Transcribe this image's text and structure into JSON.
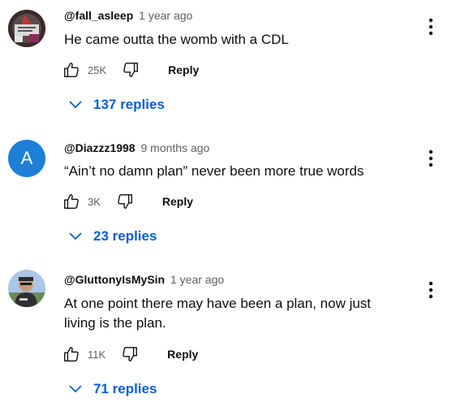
{
  "comments": [
    {
      "author": "@fall_asleep",
      "time": "1 year ago",
      "text": "He came outta the womb with a CDL",
      "likes": "25K",
      "reply_label": "Reply",
      "replies_label": "137 replies",
      "avatar_type": "image"
    },
    {
      "author": "@Diazzz1998",
      "time": "9 months ago",
      "text": "“Ain’t no damn plan” never been more true words",
      "likes": "3K",
      "reply_label": "Reply",
      "replies_label": "23 replies",
      "avatar_letter": "A",
      "avatar_color": "#1d7fd6"
    },
    {
      "author": "@GluttonyIsMySin",
      "time": "1 year ago",
      "text": "At one point there may have been a plan, now just living is the plan.",
      "likes": "11K",
      "reply_label": "Reply",
      "replies_label": "71 replies",
      "avatar_type": "image"
    }
  ],
  "icons": {
    "like": "thumbs-up-icon",
    "dislike": "thumbs-down-icon",
    "more": "more-vert-icon",
    "expand": "chevron-down-icon"
  },
  "colors": {
    "link": "#065fd4",
    "meta": "#606060"
  }
}
